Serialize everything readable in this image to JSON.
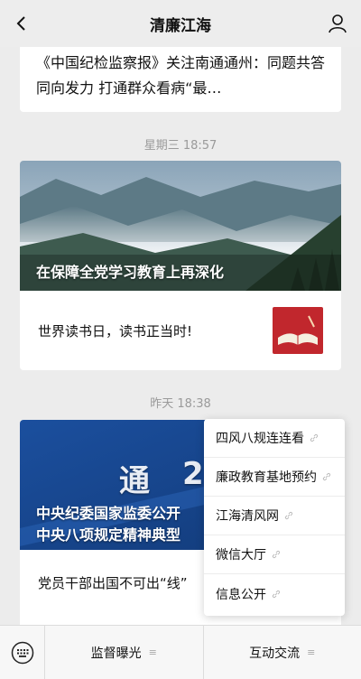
{
  "header": {
    "title": "清廉江海",
    "back_icon": "chevron-left-icon",
    "profile_icon": "person-icon"
  },
  "messages": {
    "first_card_text": "《中国纪检监察报》关注南通通州：同题共答 同向发力 打通群众看病“最…",
    "timestamp_1": "星期三 18:57",
    "article": {
      "cover_title": "在保障全党学习教育上再深化",
      "sub_title": "世界读书日，读书正当时!"
    },
    "timestamp_2": "昨天 18:38",
    "notice": {
      "banner_char_1": "通",
      "banner_char_2": "2",
      "line_1": "中央纪委国家监委公开",
      "line_2": "中央八项规定精神典型",
      "sub_title": "党员干部出国不可出“线”"
    }
  },
  "popup_menu": {
    "items": [
      "四风八规连连看",
      "廉政教育基地预约",
      "江海清风网",
      "微信大厅",
      "信息公开"
    ]
  },
  "bottom_bar": {
    "keyboard_icon": "keyboard-icon",
    "menu_1": "监督曝光",
    "menu_2": "互动交流",
    "menu_icon": "≡"
  },
  "colors": {
    "background": "#ececec",
    "card": "#ffffff",
    "timestamp": "#9a9a9a",
    "notice_blue": "#1b4f9e"
  }
}
